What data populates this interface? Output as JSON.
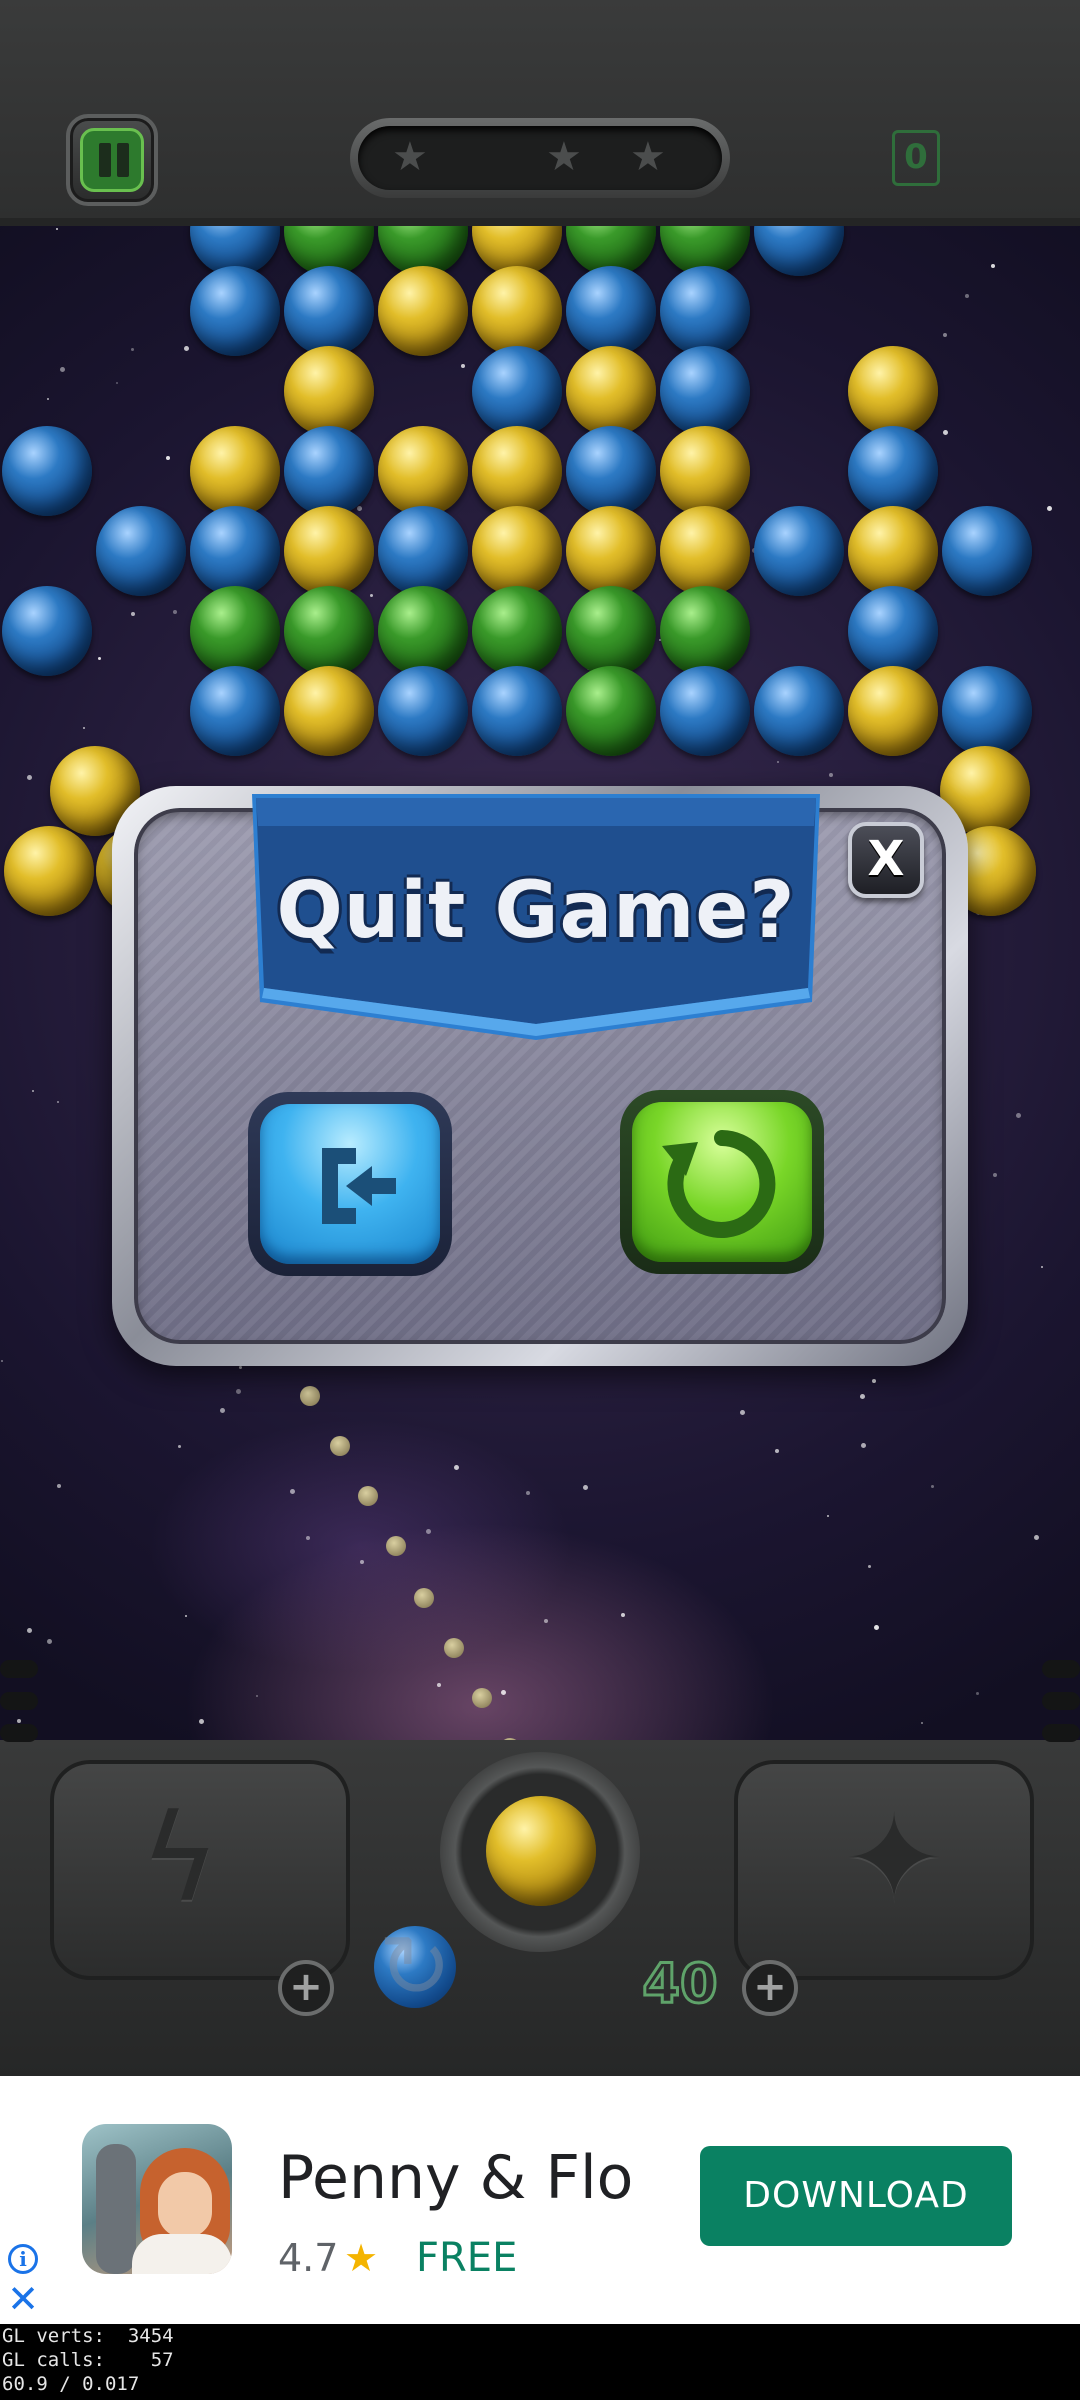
{
  "hud": {
    "pause_icon": "pause-icon",
    "stars": [
      "★",
      "★",
      "★"
    ],
    "star_icon": "star-icon",
    "score": "0"
  },
  "dialog": {
    "title": "Quit Game?",
    "close_label": "X",
    "exit_icon": "exit-icon",
    "replay_icon": "replay-icon"
  },
  "launcher": {
    "shots_left": "40",
    "plus_label": "+",
    "current_bubble_color": "yellow",
    "next_bubble_color": "blue",
    "left_powerup_icon": "lightning-icon",
    "right_powerup_icon": "star-shape-icon"
  },
  "colors": {
    "blue": "#1f5fa8",
    "yellow": "#d4ad1e",
    "green": "#2b8a22",
    "banner": "#1f4f8f",
    "exit_button": "#3fb3f0",
    "replay_button": "#79d628",
    "ad_green": "#0a8162"
  },
  "ad": {
    "title": "Penny & Flo",
    "rating": "4.7",
    "rating_star": "★",
    "price": "FREE",
    "cta": "DOWNLOAD",
    "info_label": "i",
    "close_label": "✕"
  },
  "debug": {
    "line1": "GL verts:  3454",
    "line2": "GL calls:    57",
    "line3": "60.9 / 0.017"
  }
}
